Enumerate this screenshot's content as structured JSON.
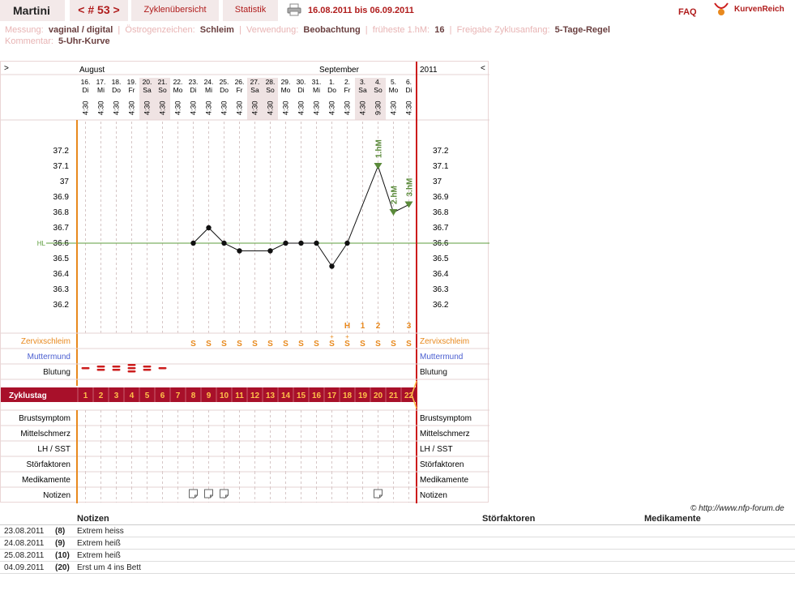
{
  "header": {
    "name": "Martini",
    "cycle_no": "< # 53 >",
    "overview": "Zyklenübersicht",
    "stats": "Statistik",
    "daterange": "16.08.2011 bis 06.09.2011",
    "faq": "FAQ",
    "brand": "KurvenReich"
  },
  "info": {
    "messung_label": "Messung:",
    "messung_value": "vaginal / digital",
    "oestrogen_label": "Östrogenzeichen:",
    "oestrogen_value": "Schleim",
    "verwendung_label": "Verwendung:",
    "verwendung_value": "Beobachtung",
    "hm_label": "früheste 1.hM:",
    "hm_value": "16",
    "freigabe_label": "Freigabe Zyklusanfang:",
    "freigabe_value": "5-Tage-Regel",
    "kommentar_label": "Kommentar:",
    "kommentar_value": "5-Uhr-Kurve"
  },
  "chart": {
    "left_toggle": ">",
    "right_toggle": "<",
    "year": "2011",
    "month1": "August",
    "month2": "September",
    "hl_label": "HL",
    "copyright": "© http://www.nfp-forum.de",
    "temp_labels": [
      "37.2",
      "37.1",
      "37",
      "36.9",
      "36.8",
      "36.7",
      "36.6",
      "36.5",
      "36.4",
      "36.3",
      "36.2"
    ],
    "dates": [
      "16.",
      "17.",
      "18.",
      "19.",
      "20.",
      "21.",
      "22.",
      "23.",
      "24.",
      "25.",
      "26.",
      "27.",
      "28.",
      "29.",
      "30.",
      "31.",
      "1.",
      "2.",
      "3.",
      "4.",
      "5.",
      "6."
    ],
    "weekdays": [
      "Di",
      "Mi",
      "Do",
      "Fr",
      "Sa",
      "So",
      "Mo",
      "Di",
      "Mi",
      "Do",
      "Fr",
      "Sa",
      "So",
      "Mo",
      "Di",
      "Mi",
      "Do",
      "Fr",
      "Sa",
      "So",
      "Mo",
      "Di"
    ],
    "times": [
      "4:30",
      "4:30",
      "4:30",
      "4:30",
      "4:30",
      "4:30",
      "4:30",
      "4:30",
      "4:30",
      "4:30",
      "4:30",
      "4:30",
      "4:30",
      "4:30",
      "4:30",
      "4:30",
      "4:30",
      "4:30",
      "4:30",
      "9:30",
      "4:30",
      "4:30"
    ],
    "weekend": [
      false,
      false,
      false,
      false,
      true,
      true,
      false,
      false,
      false,
      false,
      false,
      true,
      true,
      false,
      false,
      false,
      false,
      false,
      true,
      true,
      false,
      false
    ],
    "temps": [
      null,
      null,
      null,
      null,
      null,
      null,
      null,
      36.6,
      36.7,
      36.6,
      36.55,
      null,
      36.55,
      36.6,
      36.6,
      36.6,
      36.45,
      36.6,
      null,
      37.1,
      36.8,
      36.85
    ],
    "hl_value": 36.6,
    "hm_markers": [
      {
        "day": 20,
        "label": "1.hM"
      },
      {
        "day": 21,
        "label": "2.hM"
      },
      {
        "day": 22,
        "label": "3.hM"
      }
    ],
    "peak_labels": [
      {
        "day": 18,
        "text": "H"
      },
      {
        "day": 19,
        "text": "1"
      },
      {
        "day": 20,
        "text": "2"
      },
      {
        "day": 22,
        "text": "3"
      }
    ],
    "zervix": [
      "",
      "",
      "",
      "",
      "",
      "",
      "",
      "S",
      "S",
      "S",
      "S",
      "S",
      "S",
      "S",
      "S",
      "S",
      "S+",
      "S+",
      "S",
      "S",
      "S",
      "S"
    ],
    "bleeding": [
      1,
      2,
      2,
      3,
      2,
      1,
      0,
      0,
      0,
      0,
      0,
      0,
      0,
      0,
      0,
      0,
      0,
      0,
      0,
      0,
      0,
      0
    ],
    "notes_days": [
      8,
      9,
      10,
      20
    ],
    "cycle_days": [
      "1",
      "2",
      "3",
      "4",
      "5",
      "6",
      "7",
      "8",
      "9",
      "10",
      "11",
      "12",
      "13",
      "14",
      "15",
      "16",
      "17",
      "18",
      "19",
      "20",
      "21",
      "22"
    ],
    "rows": {
      "zervix": "Zervixschleim",
      "muttermund": "Muttermund",
      "blutung": "Blutung",
      "zyklustag": "Zyklustag",
      "brust": "Brustsymptom",
      "mittel": "Mittelschmerz",
      "lh": "LH / SST",
      "stoer": "Störfaktoren",
      "medi": "Medikamente",
      "notizen": "Notizen"
    },
    "colors": {
      "accent_red": "#cc1c1c",
      "cycle_bar": "#a8102a",
      "zervix_orange": "#e8891e",
      "muttermund_blue": "#4a5ed0",
      "hm_green": "#5a8a3a",
      "hl_line": "#5c9e3c",
      "weekend": "#efe3e3"
    }
  },
  "notes": {
    "header": {
      "notizen": "Notizen",
      "stoer": "Störfaktoren",
      "medi": "Medikamente"
    },
    "rows": [
      {
        "date": "23.08.2011",
        "day": "(8)",
        "text": "Extrem heiss"
      },
      {
        "date": "24.08.2011",
        "day": "(9)",
        "text": "Extrem heiß"
      },
      {
        "date": "25.08.2011",
        "day": "(10)",
        "text": "Extrem heiß"
      },
      {
        "date": "04.09.2011",
        "day": "(20)",
        "text": "Erst um 4 ins Bett"
      }
    ]
  }
}
